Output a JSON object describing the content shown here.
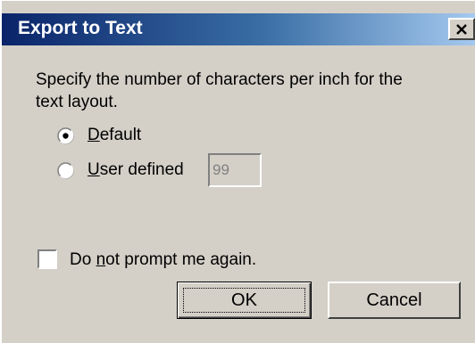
{
  "dialog": {
    "title": "Export to Text",
    "close_glyph": "×",
    "description_line1": "Specify the number of characters per inch for the",
    "description_line2": "text layout.",
    "options": [
      {
        "mnemonic": "D",
        "rest": "efault",
        "label": "Default",
        "selected": true
      },
      {
        "mnemonic": "U",
        "rest": "ser defined",
        "label": "User defined",
        "selected": false
      }
    ],
    "user_defined_value": "99",
    "dont_prompt": {
      "pre": "Do ",
      "mnemonic": "n",
      "rest": "ot prompt me again.",
      "label": "Do not prompt me again.",
      "checked": false
    },
    "ok_label": "OK",
    "cancel_label": "Cancel"
  },
  "colors": {
    "face": "#d4d0c8",
    "title_start": "#0a246a",
    "title_end": "#a6caf0"
  },
  "icons": {
    "close": "close-icon",
    "radio_selected": "radio-selected-icon",
    "radio_unselected": "radio-unselected-icon"
  }
}
